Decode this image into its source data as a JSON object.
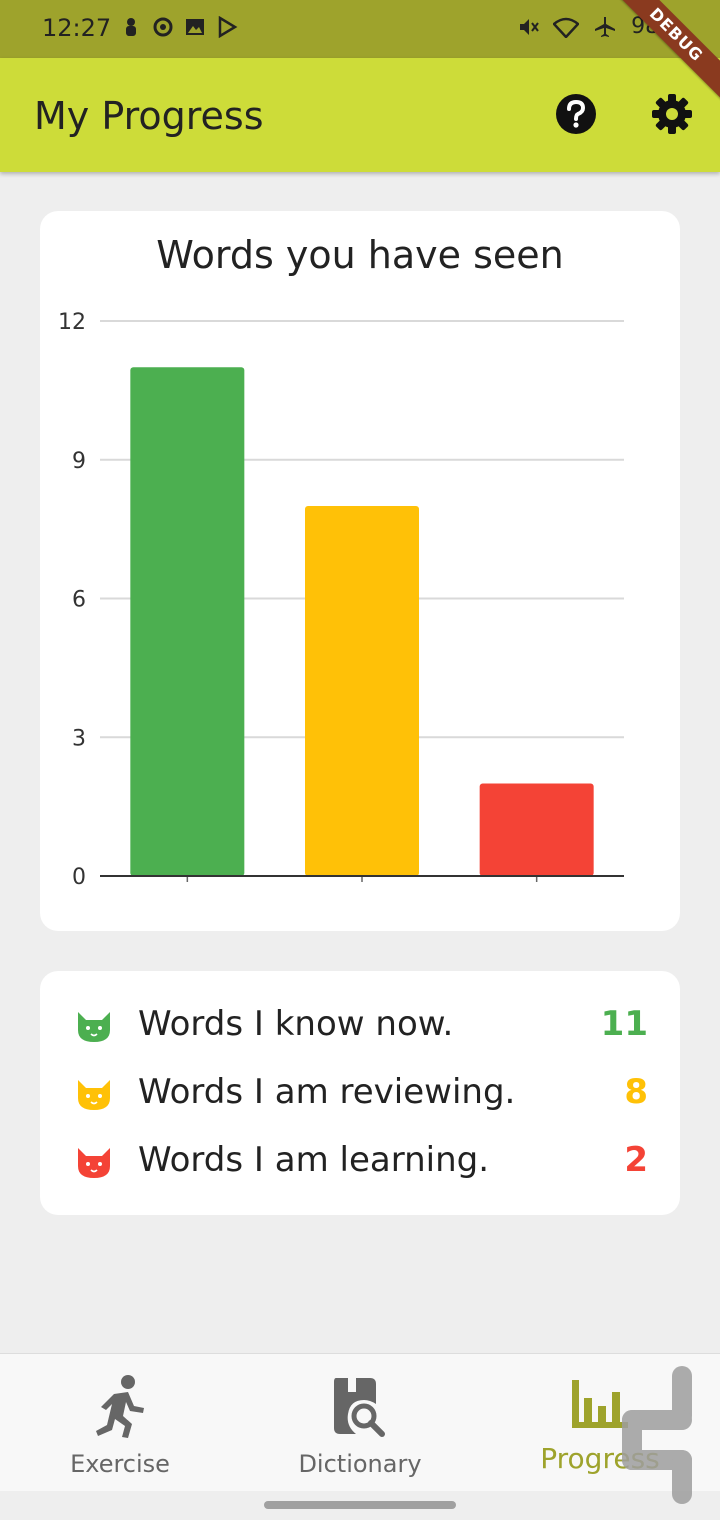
{
  "status_bar": {
    "time": "12:27",
    "battery": "98%",
    "debug_banner": "DEBUG"
  },
  "app_bar": {
    "title": "My Progress",
    "help_icon": "help-circle-icon",
    "settings_icon": "gear-icon"
  },
  "chart_card": {
    "title": "Words you have seen"
  },
  "chart_data": {
    "type": "bar",
    "categories": [
      "",
      "",
      ""
    ],
    "values": [
      11,
      8,
      2
    ],
    "colors": [
      "#4caf50",
      "#ffc107",
      "#f44336"
    ],
    "yticks": [
      "0",
      "3",
      "6",
      "9",
      "12"
    ],
    "ylim": [
      0,
      12
    ],
    "grid": true
  },
  "legend": {
    "items": [
      {
        "label": "Words I know now.",
        "count": "11",
        "color": "#4caf50",
        "icon": "cat-icon"
      },
      {
        "label": "Words I am reviewing.",
        "count": "8",
        "color": "#ffc107",
        "icon": "cat-icon"
      },
      {
        "label": "Words I am learning.",
        "count": "2",
        "color": "#f44336",
        "icon": "cat-icon"
      }
    ]
  },
  "bottom_nav": {
    "items": [
      {
        "label": "Exercise",
        "icon": "running-person-icon"
      },
      {
        "label": "Dictionary",
        "icon": "book-search-icon"
      },
      {
        "label": "Progress",
        "icon": "bar-chart-icon"
      }
    ],
    "active": "Progress",
    "active_color": "#9ea32c"
  }
}
